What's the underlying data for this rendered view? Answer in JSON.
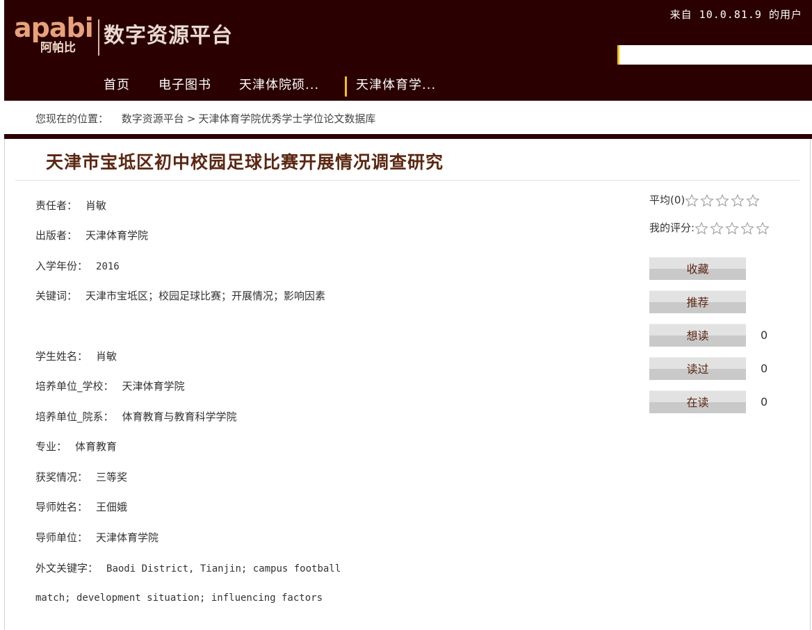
{
  "header": {
    "logo_text": "apabi",
    "logo_cn": "阿帕比",
    "platform_title": "数字资源平台",
    "from_user": "来自 10.0.81.9 的用户"
  },
  "nav": {
    "items": [
      {
        "label": "首页"
      },
      {
        "label": "电子图书"
      },
      {
        "label": "天津体院硕..."
      },
      {
        "label": "天津体育学..."
      }
    ]
  },
  "breadcrumb": {
    "prefix": "您现在的位置：",
    "items": [
      "数字资源平台",
      "天津体育学院优秀学士学位论文数据库"
    ],
    "separator": ">"
  },
  "record": {
    "title": "天津市宝坻区初中校园足球比赛开展情况调查研究",
    "fields": [
      {
        "label": "责任者：",
        "value": "肖敏"
      },
      {
        "label": "出版者：",
        "value": "天津体育学院"
      },
      {
        "label": "入学年份：",
        "value": "2016"
      },
      {
        "label": "关键词：",
        "value": "天津市宝坻区；校园足球比赛；开展情况；影响因素"
      },
      {
        "label": "学生姓名：",
        "value": "肖敏"
      },
      {
        "label": "培养单位_学校：",
        "value": "天津体育学院"
      },
      {
        "label": "培养单位_院系：",
        "value": "体育教育与教育科学学院"
      },
      {
        "label": "专业：",
        "value": "体育教育"
      },
      {
        "label": "获奖情况：",
        "value": "三等奖"
      },
      {
        "label": "导师姓名：",
        "value": "王佃娥"
      },
      {
        "label": "导师单位：",
        "value": "天津体育学院"
      }
    ],
    "foreign_keywords_label": "外文关键字：",
    "foreign_keywords_line1": "Baodi District, Tianjin; campus football",
    "foreign_keywords_line2": "match; development situation; influencing factors"
  },
  "sidebar": {
    "average_label": "平均(0)",
    "average_rating": 0,
    "my_rating_label": "我的评分:",
    "my_rating": 0,
    "star_count": 5,
    "actions": [
      {
        "label": "收藏",
        "count": ""
      },
      {
        "label": "推荐",
        "count": ""
      },
      {
        "label": "想读",
        "count": "0"
      },
      {
        "label": "读过",
        "count": "0"
      },
      {
        "label": "在读",
        "count": "0"
      }
    ]
  },
  "colors": {
    "header_bg": "#2a0000",
    "accent_yellow": "#f5c400",
    "title_brown": "#5b2712"
  }
}
